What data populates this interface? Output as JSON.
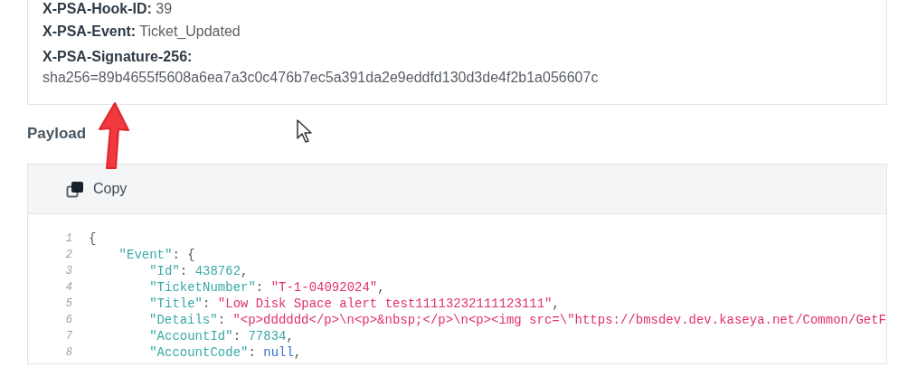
{
  "headers": [
    {
      "name": "X-PSA-Hook-ID:",
      "value": "39",
      "wrapped": false
    },
    {
      "name": "X-PSA-Event:",
      "value": "Ticket_Updated",
      "wrapped": false
    },
    {
      "name": "X-PSA-Signature-256:",
      "value": "sha256=89b4655f5608a6ea7a3c0c476b7ec5a391da2e9eddfd130d3de4f2b1a056607c",
      "wrapped": true
    }
  ],
  "payload": {
    "title": "Payload",
    "copy_button": "Copy",
    "lines": [
      {
        "number": "1",
        "tokens": [
          {
            "kind": "punct",
            "text": "{"
          }
        ]
      },
      {
        "number": "2",
        "tokens": [
          {
            "kind": "key",
            "text": "    \"Event\""
          },
          {
            "kind": "punct",
            "text": ": {"
          }
        ]
      },
      {
        "number": "3",
        "tokens": [
          {
            "kind": "key",
            "text": "        \"Id\""
          },
          {
            "kind": "punct",
            "text": ": "
          },
          {
            "kind": "number",
            "text": "438762"
          },
          {
            "kind": "punct",
            "text": ","
          }
        ]
      },
      {
        "number": "4",
        "tokens": [
          {
            "kind": "key",
            "text": "        \"TicketNumber\""
          },
          {
            "kind": "punct",
            "text": ": "
          },
          {
            "kind": "string",
            "text": "\"T-1-04092024\""
          },
          {
            "kind": "punct",
            "text": ","
          }
        ]
      },
      {
        "number": "5",
        "tokens": [
          {
            "kind": "key",
            "text": "        \"Title\""
          },
          {
            "kind": "punct",
            "text": ": "
          },
          {
            "kind": "string",
            "text": "\"Low Disk Space alert test11113232111123111\""
          },
          {
            "kind": "punct",
            "text": ","
          }
        ]
      },
      {
        "number": "6",
        "tokens": [
          {
            "kind": "key",
            "text": "        \"Details\""
          },
          {
            "kind": "punct",
            "text": ": "
          },
          {
            "kind": "string",
            "text": "\"<p>dddddd</p>\\n<p>&nbsp;</p>\\n<p><img src=\\\"https://bmsdev.dev.kaseya.net/Common/GetF"
          }
        ]
      },
      {
        "number": "7",
        "tokens": [
          {
            "kind": "key",
            "text": "        \"AccountId\""
          },
          {
            "kind": "punct",
            "text": ": "
          },
          {
            "kind": "number",
            "text": "77834"
          },
          {
            "kind": "punct",
            "text": ","
          }
        ]
      },
      {
        "number": "8",
        "tokens": [
          {
            "kind": "key",
            "text": "        \"AccountCode\""
          },
          {
            "kind": "punct",
            "text": ": "
          },
          {
            "kind": "null",
            "text": "null"
          },
          {
            "kind": "punct",
            "text": ","
          }
        ]
      }
    ]
  }
}
